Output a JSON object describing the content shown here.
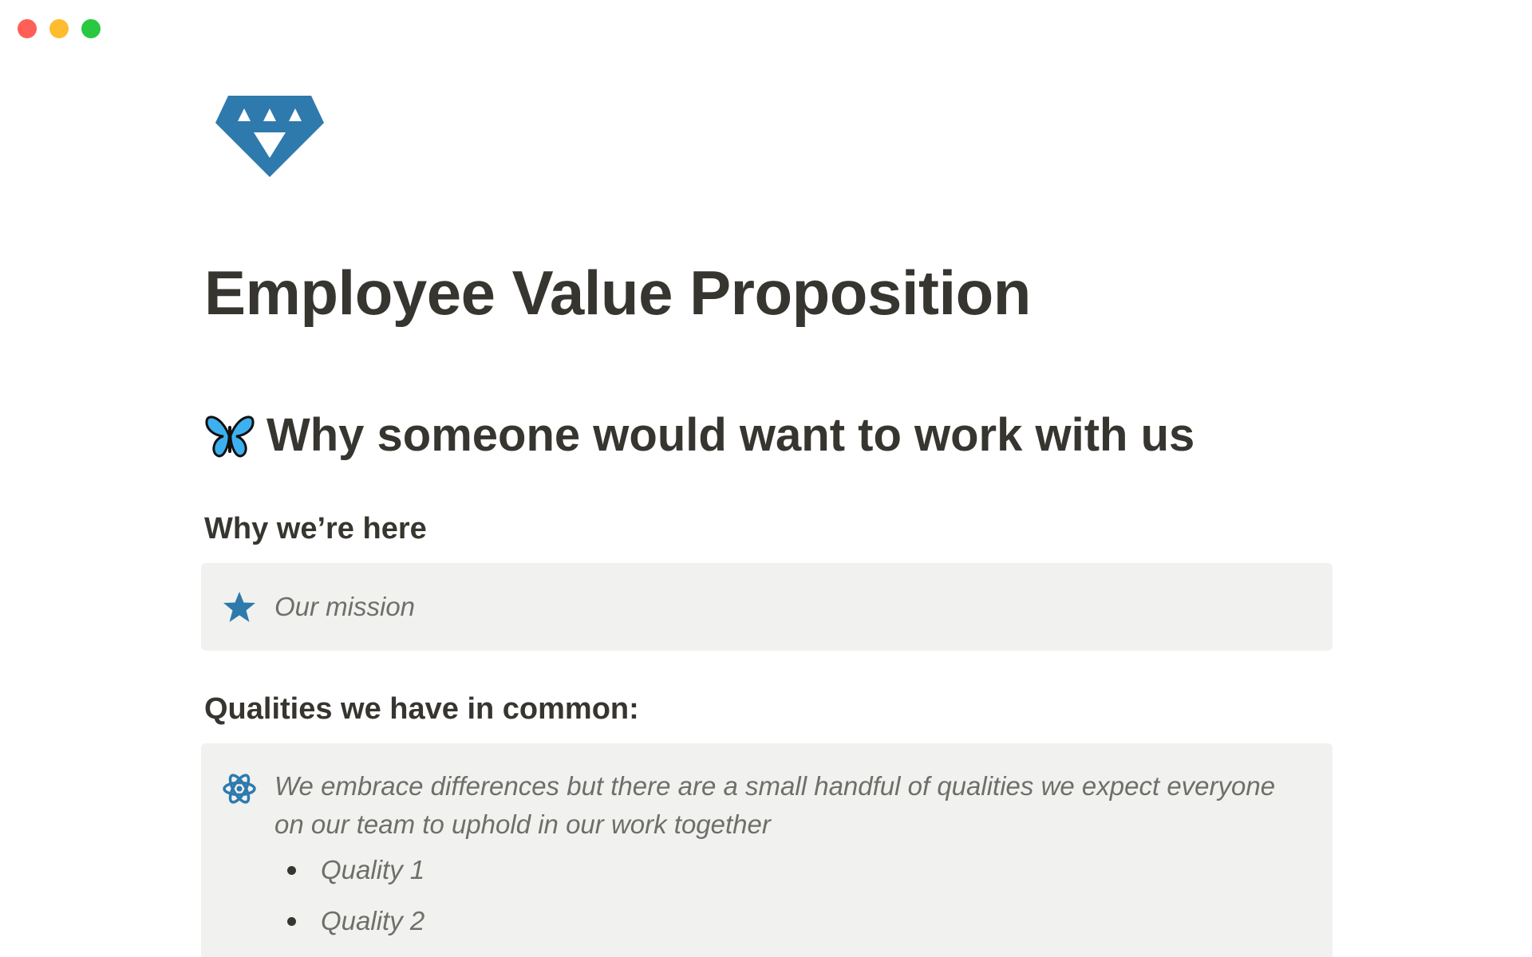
{
  "page": {
    "icon": "gem-icon",
    "title": "Employee Value Proposition"
  },
  "section": {
    "emoji": "butterfly-icon",
    "heading": "Why someone would want to work with us"
  },
  "why_here": {
    "heading": "Why we’re here",
    "callout_icon": "star-icon",
    "callout_text": "Our mission"
  },
  "qualities": {
    "heading": "Qualities we have in common:",
    "callout_icon": "atom-icon",
    "callout_text": "We embrace differences but there are a small handful of qualities we expect everyone on our team to uphold in our work together",
    "items": [
      "Quality 1",
      "Quality 2"
    ]
  },
  "colors": {
    "accent": "#2e7aad",
    "callout_bg": "#f1f1ef",
    "text": "#37352f",
    "muted_text": "#6f6e69"
  }
}
